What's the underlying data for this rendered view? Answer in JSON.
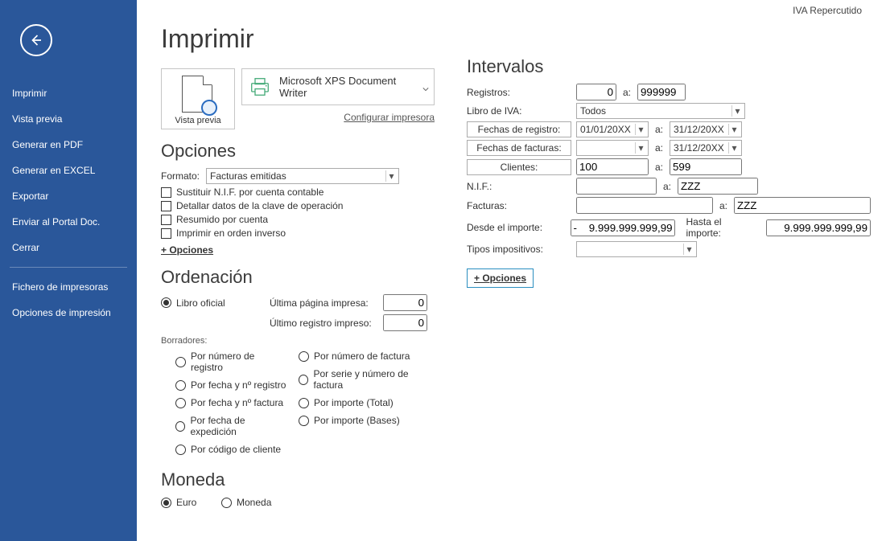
{
  "context_label": "IVA Repercutido",
  "sidebar": {
    "items": [
      "Imprimir",
      "Vista previa",
      "Generar en PDF",
      "Generar en EXCEL",
      "Exportar",
      "Enviar al Portal Doc.",
      "Cerrar"
    ],
    "items2": [
      "Fichero de impresoras",
      "Opciones de impresión"
    ]
  },
  "page_title": "Imprimir",
  "preview_label": "Vista previa",
  "printer": {
    "name": "Microsoft XPS Document Writer",
    "configure": "Configurar impresora"
  },
  "opciones": {
    "title": "Opciones",
    "formato_label": "Formato:",
    "formato_value": "Facturas emitidas",
    "chk1": "Sustituir N.I.F. por cuenta contable",
    "chk2": "Detallar datos de la clave de operación",
    "chk3": "Resumido por cuenta",
    "chk4": "Imprimir en orden inverso",
    "more": "+ Opciones"
  },
  "ordenacion": {
    "title": "Ordenación",
    "r1": "Libro oficial",
    "last_page_label": "Última página impresa:",
    "last_page_value": "0",
    "last_reg_label": "Último registro impreso:",
    "last_reg_value": "0",
    "borradores_label": "Borradores:",
    "left": [
      "Por número de registro",
      "Por fecha y nº registro",
      "Por fecha y nº factura",
      "Por fecha de expedición",
      "Por código de cliente"
    ],
    "right": [
      "Por número de factura",
      "Por serie y número de factura",
      "Por importe (Total)",
      "Por importe (Bases)"
    ]
  },
  "moneda": {
    "title": "Moneda",
    "r1": "Euro",
    "r2": "Moneda"
  },
  "intervalos": {
    "title": "Intervalos",
    "registros_label": "Registros:",
    "reg_from": "0",
    "a": "a:",
    "reg_to": "999999",
    "libro_label": "Libro de IVA:",
    "libro_value": "Todos",
    "btn_fechas_reg": "Fechas de registro:",
    "fr_from": "01/01/20XX",
    "fr_to": "31/12/20XX",
    "btn_fechas_fac": "Fechas de facturas:",
    "ff_from": "",
    "ff_to": "31/12/20XX",
    "btn_clientes": "Clientes:",
    "cli_from": "100",
    "cli_to": "599",
    "nif_label": "N.I.F.:",
    "nif_from": "",
    "nif_to": "ZZZ",
    "facturas_label": "Facturas:",
    "fac_from": "",
    "fac_to": "ZZZ",
    "importe_from_label": "Desde el importe:",
    "importe_from": "-    9.999.999.999,99",
    "importe_to_label": "Hasta el importe:",
    "importe_to": "9.999.999.999,99",
    "tipos_label": "Tipos impositivos:",
    "tipos_value": "",
    "more": "+ Opciones"
  }
}
